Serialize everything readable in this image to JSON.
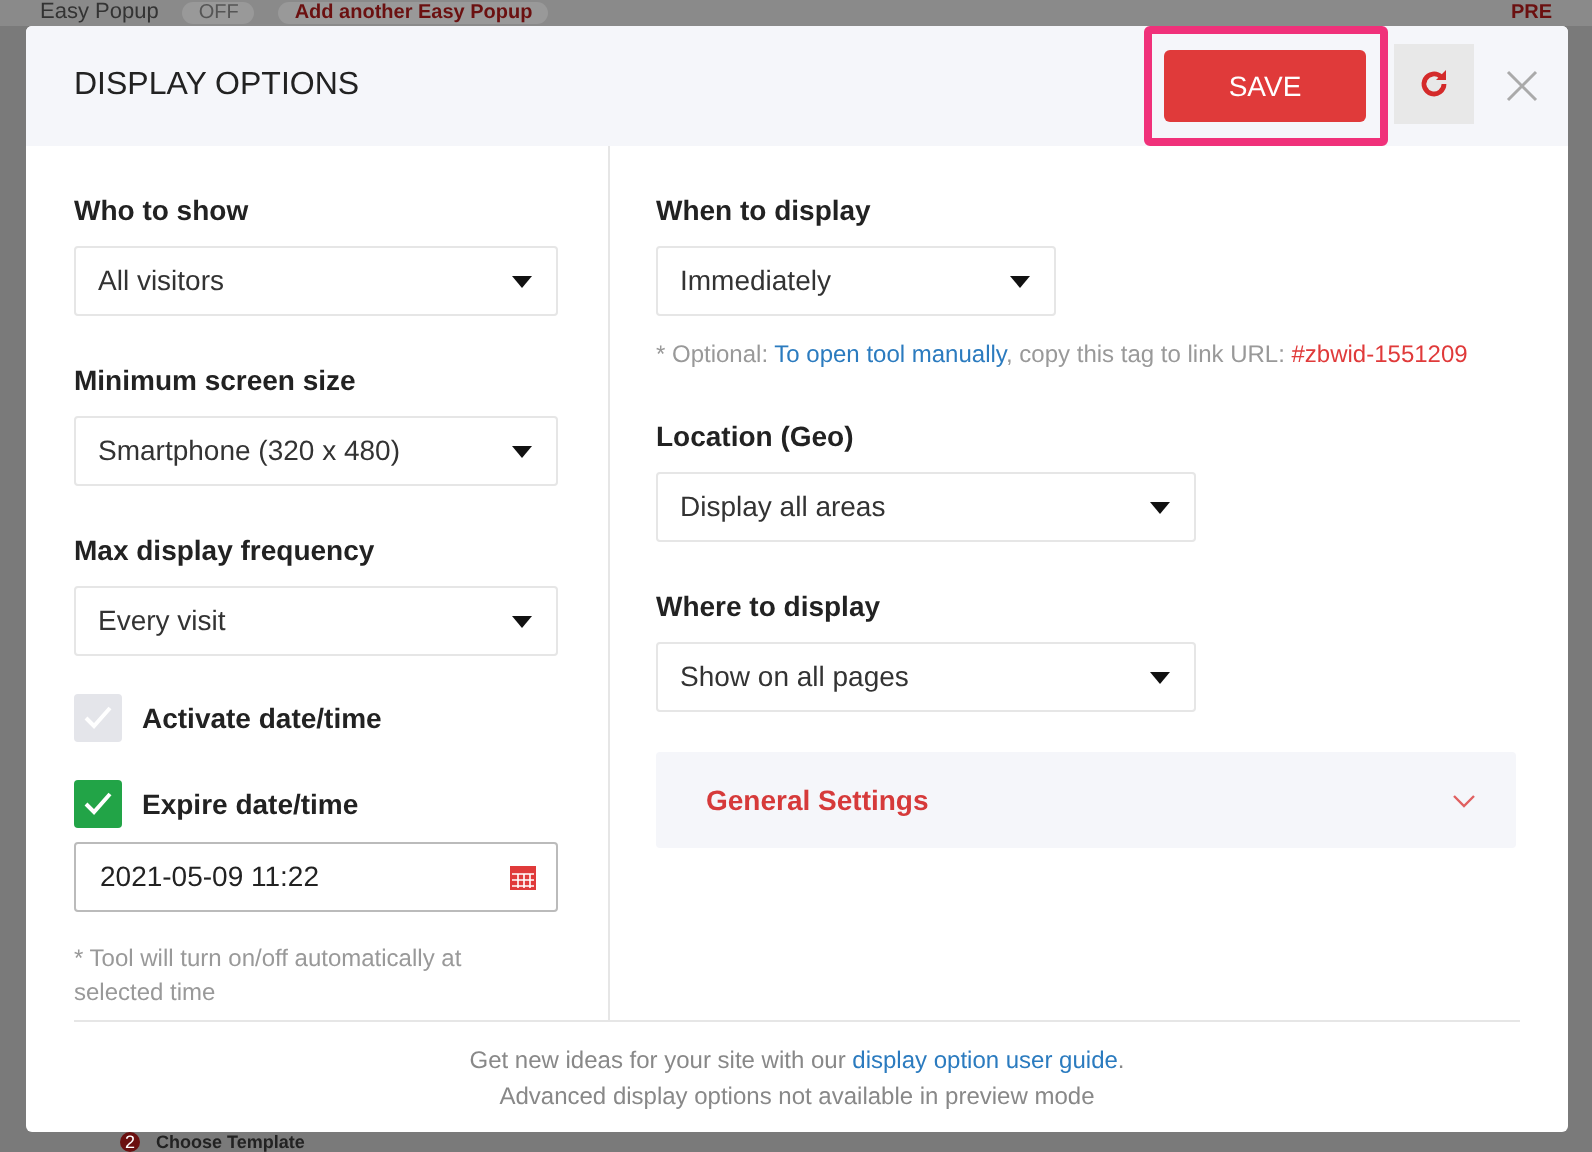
{
  "background": {
    "title": "Easy Popup",
    "toggle": {
      "label": "OFF",
      "on": false
    },
    "add_button": "Add another Easy Popup",
    "corner_text": "PRE",
    "step": {
      "number": "2",
      "label": "Choose Template"
    }
  },
  "dialog": {
    "title": "DISPLAY OPTIONS",
    "save_button": "SAVE"
  },
  "left_fields": [
    {
      "kind": "select",
      "label": "Who to show",
      "value": "All visitors"
    },
    {
      "kind": "select",
      "label": "Minimum screen size",
      "value": "Smartphone (320 x 480)"
    },
    {
      "kind": "select",
      "label": "Max display frequency",
      "value": "Every visit"
    },
    {
      "kind": "checkbox",
      "label": "Activate date/time",
      "checked": false
    },
    {
      "kind": "checkbox",
      "label": "Expire date/time",
      "checked": true
    },
    {
      "kind": "date",
      "value": "2021-05-09 11:22"
    },
    {
      "kind": "note",
      "text": "* Tool will turn on/off automatically at selected time"
    }
  ],
  "right_fields": [
    {
      "kind": "select",
      "label": "When to display",
      "value": "Immediately"
    },
    {
      "kind": "hint",
      "prefix": "* Optional: ",
      "link": "To open tool manually",
      "middle": ", copy this tag to link URL: ",
      "tag": "#zbwid-1551209"
    },
    {
      "kind": "select",
      "label": "Location (Geo)",
      "value": "Display all areas"
    },
    {
      "kind": "select",
      "label": "Where to display",
      "value": "Show on all pages"
    },
    {
      "kind": "accordion",
      "label": "General Settings",
      "expanded": false
    }
  ],
  "footer": {
    "prefix": "Get new ideas for your site with our ",
    "link": "display option user guide",
    "suffix": ".",
    "note": "Advanced display options not available in preview mode"
  }
}
